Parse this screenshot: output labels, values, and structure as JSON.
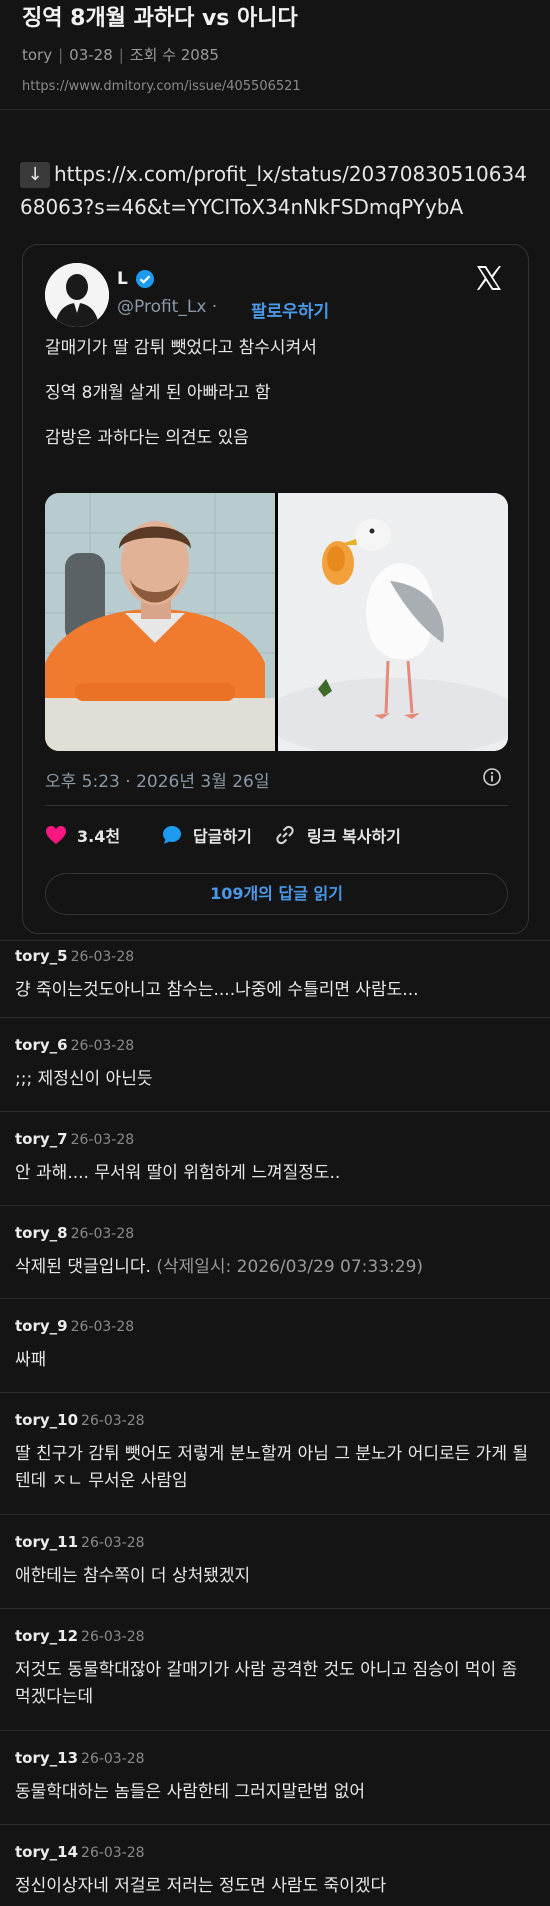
{
  "post": {
    "title": "징역 8개월 과하다 vs 아니다",
    "author": "tory",
    "date": "03-28",
    "views_label": "조회 수 2085",
    "url": "https://www.dmitory.com/issue/405506521"
  },
  "body": {
    "link_arrow": "↓",
    "link_text": "https://x.com/profit_lx/status/2037083051063468063?s=46&t=YYCIToX34nNkFSDmqPYybA"
  },
  "tweet": {
    "name": "L",
    "handle": "@Profit_Lx",
    "dot": "·",
    "follow_label": "팔로우하기",
    "lines": [
      "갈매기가 딸 감튀 뺏었다고 참수시켜서",
      "징역 8개월 살게 된 아빠라고 함",
      "감방은 과하다는 의견도 있음"
    ],
    "timestamp": "오후 5:23 · 2026년 3월 26일",
    "like_count": "3.4천",
    "reply_label": "답글하기",
    "copy_link_label": "링크 복사하기",
    "read_replies_label": "109개의 답글 읽기",
    "colors": {
      "like": "#f91880",
      "reply": "#1d9bf0",
      "link": "#4a99e9"
    }
  },
  "comments": [
    {
      "author": "tory_5",
      "date": "26-03-28",
      "text": "걍 죽이는것도아니고 참수는....나중에 수틀리면 사람도...",
      "note": ""
    },
    {
      "author": "tory_6",
      "date": "26-03-28",
      "text": ";;; 제정신이 아닌듯",
      "note": ""
    },
    {
      "author": "tory_7",
      "date": "26-03-28",
      "text": "안 과해.... 무서워 딸이 위험하게 느껴질정도..",
      "note": ""
    },
    {
      "author": "tory_8",
      "date": "26-03-28",
      "text": "삭제된 댓글입니다.",
      "note": " (삭제일시: 2026/03/29 07:33:29)"
    },
    {
      "author": "tory_9",
      "date": "26-03-28",
      "text": "싸패",
      "note": ""
    },
    {
      "author": "tory_10",
      "date": "26-03-28",
      "text": "딸 친구가 감튀 뺏어도 저렇게 분노할꺼 아님 그 분노가 어디로든 가게 될텐데 ㅈㄴ 무서운 사람임",
      "note": ""
    },
    {
      "author": "tory_11",
      "date": "26-03-28",
      "text": "애한테는 참수쪽이 더 상처됐겠지",
      "note": ""
    },
    {
      "author": "tory_12",
      "date": "26-03-28",
      "text": "저것도 동물학대잖아 갈매기가 사람 공격한 것도 아니고 짐승이 먹이 좀 먹겠다는데",
      "note": ""
    },
    {
      "author": "tory_13",
      "date": "26-03-28",
      "text": "동물학대하는 놈들은 사람한테 그러지말란법 없어",
      "note": ""
    },
    {
      "author": "tory_14",
      "date": "26-03-28",
      "text": "정신이상자네 저걸로 저러는 정도면 사람도 죽이겠다",
      "note": ""
    }
  ]
}
